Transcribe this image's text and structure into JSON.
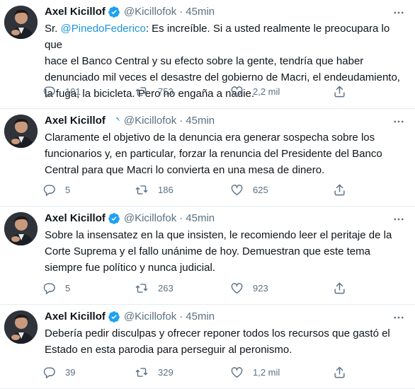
{
  "author": {
    "name": "Axel Kicillof",
    "handle": "@Kicillofok",
    "separator": "·",
    "verified_color": "#1da1f2"
  },
  "colors": {
    "text": "#0f1419",
    "secondary": "#5b7083",
    "link": "#1b95e0",
    "divider": "#e6ecf0"
  },
  "icons": {
    "reply": "reply-icon",
    "retweet": "retweet-icon",
    "like": "heart-icon",
    "share": "share-icon",
    "more": "more-dots-icon",
    "verified": "verified-badge-icon"
  },
  "tweets": [
    {
      "time": "45min",
      "text_prefix": "Sr. ",
      "mention": "@PinedoFederico",
      "text": ": Es increíble. Si a usted realmente le preocupara lo que\nhace el Banco Central y su efecto sobre la gente, tendría que haber\ndenunciado mil veces el desastre del gobierno de Macri, el endeudamiento,\nla fuga, la bicicleta. Pero no engaña a nadie.",
      "replies": "101",
      "retweets": "753",
      "likes": "2,2 mil"
    },
    {
      "time": "45min",
      "text_prefix": "",
      "mention": "",
      "text": "Claramente el objetivo de la denuncia era generar sospecha sobre los\nfuncionarios y, en particular, forzar la renuncia del Presidente del Banco\nCentral para que Macri lo convierta en una mesa de dinero.",
      "replies": "5",
      "retweets": "186",
      "likes": "625"
    },
    {
      "time": "45min",
      "text_prefix": "",
      "mention": "",
      "text": "Sobre la insensatez en la que insisten, le recomiendo leer el peritaje de la\nCorte Suprema y el fallo unánime de hoy. Demuestran que este tema\nsiempre fue político y nunca judicial.",
      "replies": "5",
      "retweets": "263",
      "likes": "923"
    },
    {
      "time": "45min",
      "text_prefix": "",
      "mention": "",
      "text": "Debería pedir disculpas y ofrecer reponer todos los recursos que gastó el\nEstado en esta parodia para perseguir al peronismo.",
      "replies": "39",
      "retweets": "329",
      "likes": "1,2 mil"
    }
  ]
}
